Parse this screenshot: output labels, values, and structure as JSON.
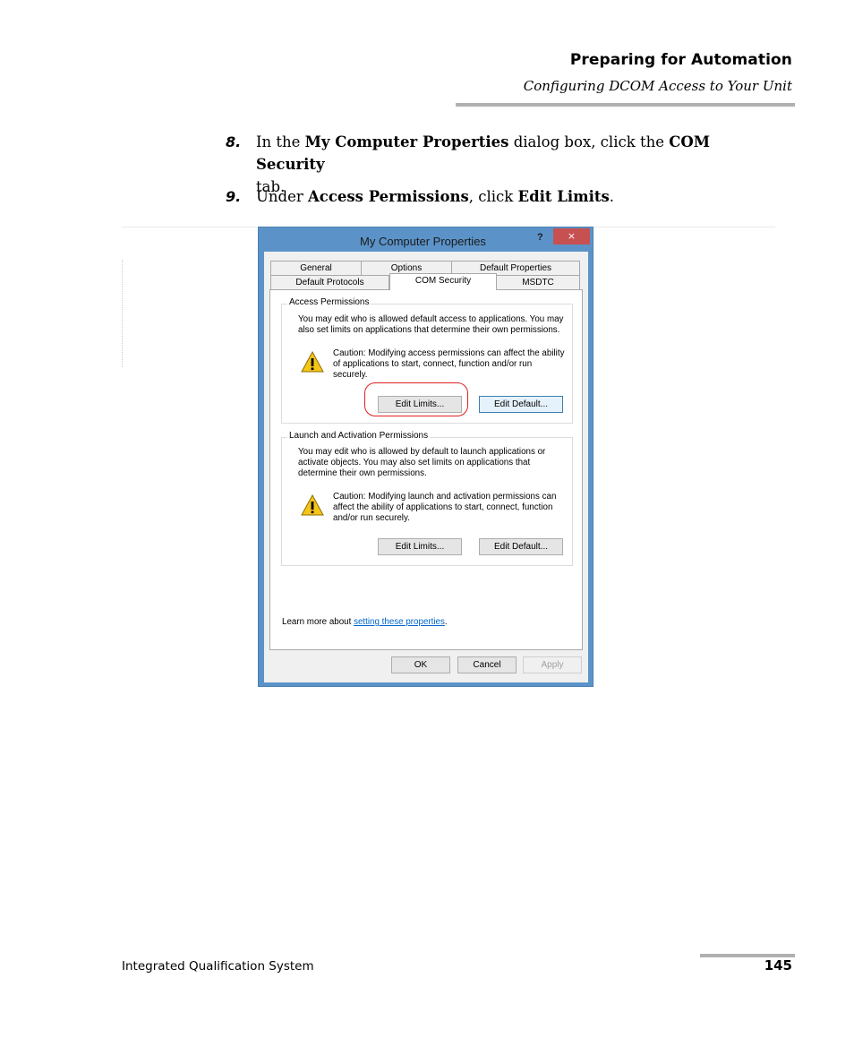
{
  "header": {
    "title": "Preparing for Automation",
    "subtitle": "Configuring DCOM Access to Your Unit"
  },
  "steps": [
    {
      "number": "8.",
      "t1": "In the ",
      "b1": "My Computer Properties",
      "t2": " dialog box, click the ",
      "b2": "COM Security",
      "t3": " tab."
    },
    {
      "number": "9.",
      "t1": "Under ",
      "b1": "Access Permissions",
      "t2": ", click ",
      "b2": "Edit Limits",
      "t3": "."
    }
  ],
  "dialog": {
    "title": "My Computer Properties",
    "help": "?",
    "close": "×",
    "tabs_row1": [
      "General",
      "Options",
      "Default Properties"
    ],
    "tabs_row2": [
      "Default Protocols",
      "COM Security",
      "MSDTC"
    ],
    "active_tab": "COM Security",
    "access": {
      "label": "Access Permissions",
      "desc_1": "You may edit who is allowed default access to applications. You may",
      "desc_2": "also set limits on applications that determine their own permissions.",
      "caution_1": "Caution: Modifying access permissions can affect the ability",
      "caution_2": "of applications to start, connect, function and/or run",
      "caution_3": "securely.",
      "edit_limits": "Edit Limits...",
      "edit_default": "Edit Default..."
    },
    "launch": {
      "label": "Launch and Activation Permissions",
      "desc_1": "You may edit who is allowed by default to launch applications or",
      "desc_2": "activate objects. You may also set limits on applications that",
      "desc_3": "determine their own permissions.",
      "caution_1": "Caution: Modifying launch and activation permissions can",
      "caution_2": "affect the ability of applications to start, connect, function",
      "caution_3": "and/or run securely.",
      "edit_limits": "Edit Limits...",
      "edit_default": "Edit Default..."
    },
    "learn_prefix": "Learn more about ",
    "learn_link": "setting these properties",
    "learn_suffix": ".",
    "ok": "OK",
    "cancel": "Cancel",
    "apply": "Apply"
  },
  "footer": {
    "left": "Integrated Qualification System",
    "page": "145"
  },
  "colors": {
    "dialog_frame": "#5b93c8",
    "close_button": "#c75050",
    "highlight_circle": "#e02020",
    "link": "#0066cc"
  }
}
